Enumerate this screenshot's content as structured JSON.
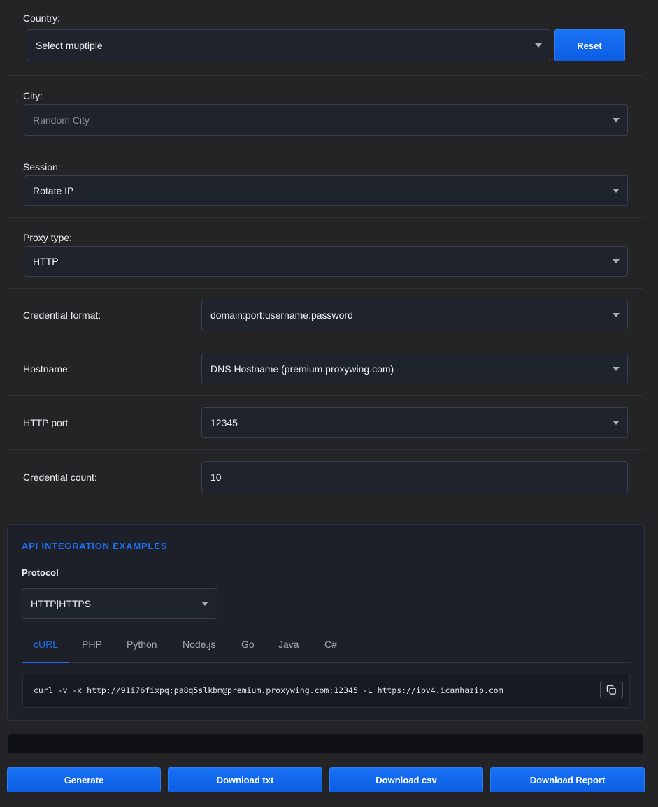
{
  "country": {
    "label": "Country:",
    "value": "Select muptiple",
    "reset_label": "Reset"
  },
  "city": {
    "label": "City:",
    "value": "Random City"
  },
  "session": {
    "label": "Session:",
    "value": "Rotate IP"
  },
  "proxy_type": {
    "label": "Proxy type:",
    "value": "HTTP"
  },
  "credential_format": {
    "label": "Credential format:",
    "value": "domain:port:username:password"
  },
  "hostname": {
    "label": "Hostname:",
    "value": "DNS Hostname (premium.proxywing.com)"
  },
  "http_port": {
    "label": "HTTP port",
    "value": "12345"
  },
  "credential_count": {
    "label": "Credential count:",
    "value": "10"
  },
  "api": {
    "title": "API INTEGRATION EXAMPLES",
    "protocol_label": "Protocol",
    "protocol_value": "HTTP|HTTPS",
    "tabs": [
      "cURL",
      "PHP",
      "Python",
      "Node.js",
      "Go",
      "Java",
      "C#"
    ],
    "active_tab": "cURL",
    "code": "curl -v -x http://91i76fixpq:pa8q5slkbm@premium.proxywing.com:12345 -L https://ipv4.icanhazip.com",
    "copy_icon": "copy-icon"
  },
  "output": {
    "value": ""
  },
  "actions": {
    "generate": "Generate",
    "download_txt": "Download txt",
    "download_csv": "Download csv",
    "download_report": "Download Report"
  },
  "colors": {
    "accent": "#1f6ff0",
    "background": "#242426",
    "field": "#1f232c"
  }
}
